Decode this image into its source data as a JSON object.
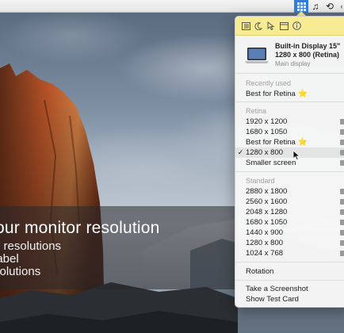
{
  "menubar": {
    "icons": [
      "resolution-grid-icon",
      "music-note-icon",
      "time-machine-icon"
    ],
    "glyph_note": "♫",
    "glyph_clock": "⟲"
  },
  "banner": {
    "title": "our monitor resolution",
    "line1": "d resolutions",
    "line2": "label",
    "line3": "solutions"
  },
  "menu": {
    "toolbar_icons": [
      "list-icon",
      "moon-icon",
      "cursor-icon",
      "window-icon",
      "info-icon"
    ],
    "display": {
      "name": "Built-in Display 15\"",
      "mode": "1280 x 800 (Retina)",
      "subtitle": "Main display"
    },
    "recent": {
      "heading": "Recently used",
      "items": [
        {
          "label": "Best for Retina",
          "star": true
        }
      ]
    },
    "retina": {
      "heading": "Retina",
      "items": [
        {
          "label": "1920 x 1200",
          "checked": false,
          "star": false
        },
        {
          "label": "1680 x 1050",
          "checked": false,
          "star": false
        },
        {
          "label": "Best for Retina",
          "checked": false,
          "star": true
        },
        {
          "label": "1280 x 800",
          "checked": true,
          "star": false
        },
        {
          "label": "Smaller screen",
          "checked": false,
          "star": false
        }
      ]
    },
    "standard": {
      "heading": "Standard",
      "items": [
        "2880 x 1800",
        "2560 x 1600",
        "2048 x 1280",
        "1680 x 1050",
        "1440 x 900",
        "1280 x 800",
        "1024 x 768"
      ]
    },
    "rotation": "Rotation",
    "screenshot": "Take a Screenshot",
    "test_card": "Show Test Card",
    "star_glyph": "⭐",
    "check_glyph": "✓"
  },
  "colors": {
    "menubar_active": "#2f7de1",
    "toolbar_yellow": "#f7ec93",
    "star": "#f1c232"
  }
}
